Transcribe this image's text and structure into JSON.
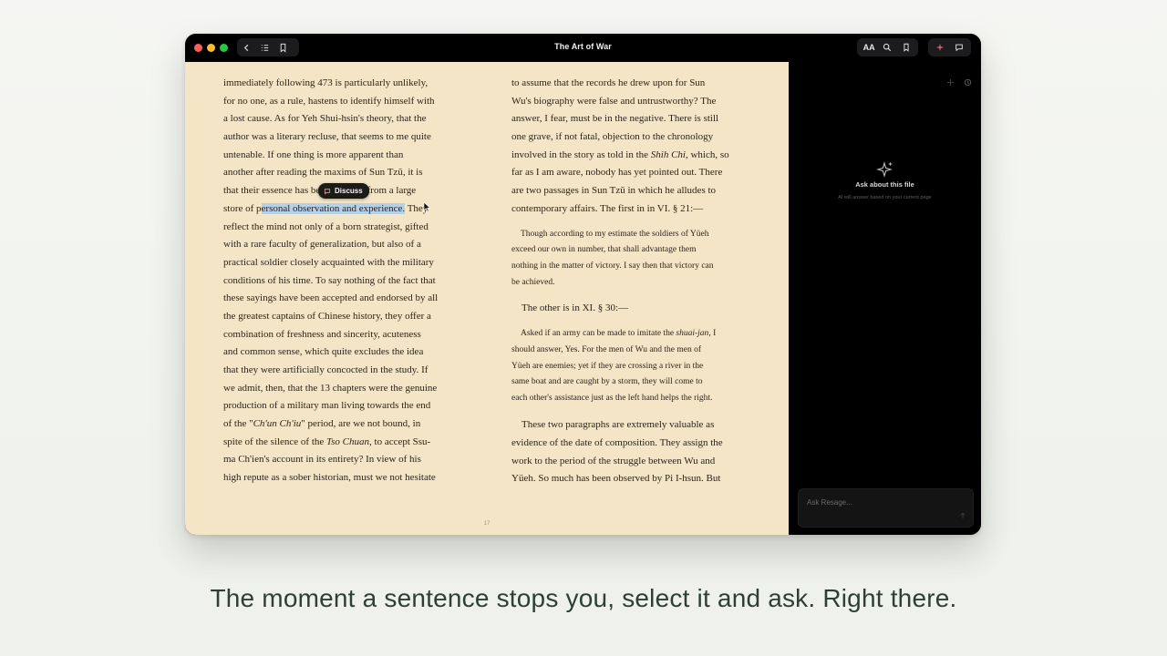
{
  "window": {
    "title": "The Art of War"
  },
  "toolbar": {
    "left_icons": [
      "chevron-left-icon",
      "list-icon",
      "bookmark-icon"
    ],
    "font_button_label": "AA",
    "right_icons": [
      "search-icon",
      "bookmark-icon",
      "sparkle-icon",
      "chat-icon"
    ]
  },
  "reader": {
    "left_lines": [
      "immediately following 473 is particularly unlikely,",
      "for no one, as a rule, hastens to identify himself with",
      "a lost cause. As for Yeh Shui-hsin's theory, that the",
      "author was a literary recluse, that seems to me quite",
      "untenable. If one thing is more apparent than",
      "another after reading the maxims of Sun Tzŭ, it is"
    ],
    "line7_pre": "that their essence has ",
    "line7_hidden": "been distill",
    "line7_post": "ed from a large",
    "line8_pre": "store of p",
    "line8_selected": "ersonal observation and experience.",
    "line8_post": " They",
    "left_lines_b": [
      "reflect the mind not only of a born strategist, gifted",
      "with a rare faculty of generalization, but also of a",
      "practical soldier closely acquainted with the military",
      "conditions of his time. To say nothing of the fact that",
      "these sayings have been accepted and endorsed by all",
      "the greatest captains of Chinese history, they offer a",
      "combination of freshness and sincerity, acuteness",
      "and common sense, which quite excludes the idea",
      "that they were artificially concocted in the study. If",
      "we admit, then, that the 13 chapters were the genuine",
      "production of a military man living towards the end"
    ],
    "line_chun_pre": "of the \"",
    "line_chun_italic": "Ch'un Ch'iu",
    "line_chun_post": "\" period, are we not bound, in",
    "line_tso_pre": "spite of the silence of the ",
    "line_tso_italic": "Tso Chuan",
    "line_tso_post": ", to accept Ssu-",
    "left_lines_c": [
      "ma Ch'ien's account in its entirety? In view of his",
      "high repute as a sober historian, must we not hesitate"
    ],
    "right_lines_a": [
      "to assume that the records he drew upon for Sun",
      "Wu's biography were false and untrustworthy? The",
      "answer, I fear, must be in the negative. There is still",
      "one grave, if not fatal, objection to the chronology"
    ],
    "line_shih_pre": "involved in the story as told in the ",
    "line_shih_italic": "Shih Chi",
    "line_shih_post": ", which, so",
    "right_lines_b": [
      "far as I am aware, nobody has yet pointed out. There",
      "are two passages in Sun Tzŭ in which he alludes to",
      "contemporary affairs. The first in in VI. § 21:—"
    ],
    "quote1_lines": [
      "Though according to my estimate the soldiers of Yüeh",
      "exceed our own in number, that shall advantage them",
      "nothing in the matter of victory. I say then that victory can",
      "be achieved."
    ],
    "other_line": "The other is in XI. § 30:—",
    "quote2_first_pre": "Asked if an army can be made to imitate the ",
    "quote2_first_italic": "shuai-jan",
    "quote2_first_post": ", I",
    "quote2_lines": [
      "should answer, Yes. For the men of Wu and the men of",
      "Yüeh are enemies; yet if they are crossing a river in the",
      "same boat and are caught by a storm, they will come to",
      "each other's assistance just as the left hand helps the right."
    ],
    "closing_lines": [
      "These two paragraphs are extremely valuable as",
      "evidence of the date of composition. They assign the",
      "work to the period of the struggle between Wu and",
      "Yüeh. So much has been observed by Pi I-hsun. But"
    ],
    "page_number": "17"
  },
  "discuss_popup": {
    "label": "Discuss"
  },
  "sidebar": {
    "title": "Ask about this file",
    "subtitle": "AI will answer based on your current page",
    "input_placeholder": "Ask Resage..."
  },
  "caption": "The moment a sentence stops you, select it and ask. Right there."
}
